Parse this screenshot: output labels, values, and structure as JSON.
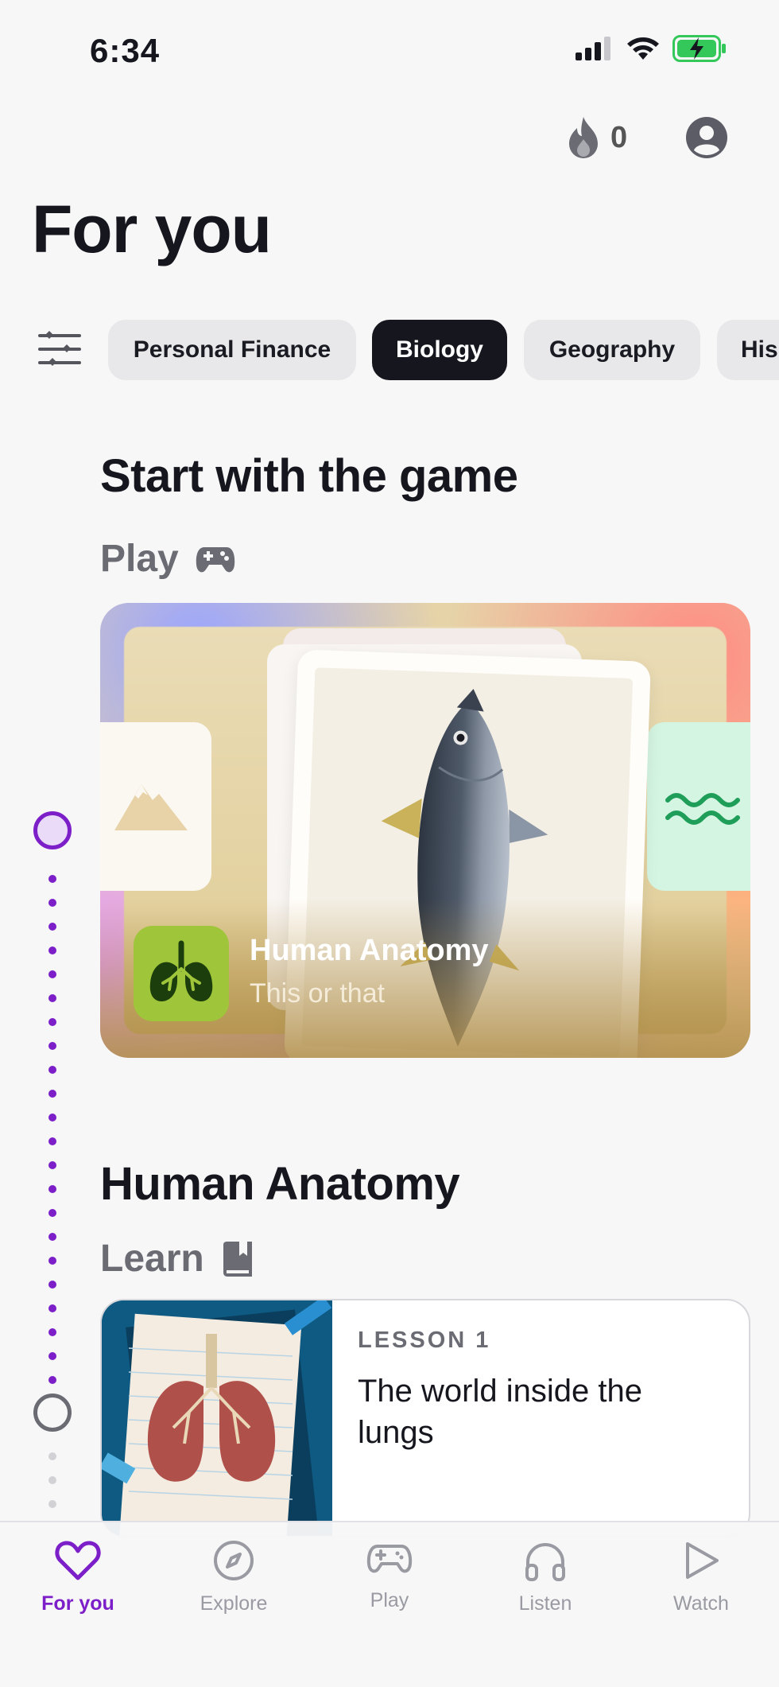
{
  "status_bar": {
    "time": "6:34"
  },
  "header": {
    "streak_count": "0",
    "title": "For you"
  },
  "chips": [
    {
      "label": "Personal Finance",
      "active": false
    },
    {
      "label": "Biology",
      "active": true
    },
    {
      "label": "Geography",
      "active": false
    },
    {
      "label": "His",
      "active": false
    }
  ],
  "section_game": {
    "title": "Start with the game",
    "subtitle": "Play",
    "card": {
      "title": "Human Anatomy",
      "subtitle": "This or that"
    }
  },
  "section_learn": {
    "title": "Human Anatomy",
    "subtitle": "Learn",
    "lesson": {
      "label": "LESSON 1",
      "title": "The world inside the lungs"
    }
  },
  "tabbar": {
    "items": [
      {
        "label": "For you",
        "icon": "heart-icon",
        "active": true
      },
      {
        "label": "Explore",
        "icon": "compass-icon",
        "active": false
      },
      {
        "label": "Play",
        "icon": "gamepad-icon",
        "active": false
      },
      {
        "label": "Listen",
        "icon": "headphones-icon",
        "active": false
      },
      {
        "label": "Watch",
        "icon": "play-icon",
        "active": false
      }
    ]
  },
  "colors": {
    "accent": "#7c1fc9",
    "chip_active": "#16161e",
    "chip_inactive": "#e8e8ea",
    "battery": "#34c759"
  }
}
